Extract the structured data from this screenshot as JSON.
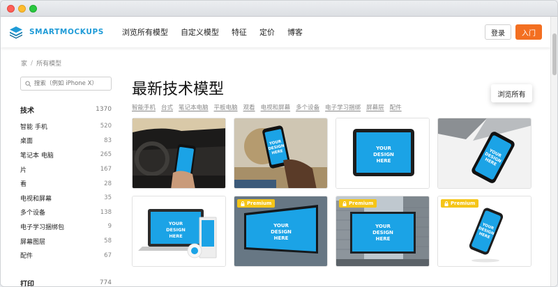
{
  "brand": {
    "name": "SMARTMOCKUPS",
    "accent": "#1f9bd7",
    "cta_color": "#f36f21"
  },
  "nav": {
    "links": [
      "浏览所有模型",
      "自定义模型",
      "特征",
      "定价",
      "博客"
    ],
    "login_label": "登录",
    "join_label": "入门"
  },
  "breadcrumb": {
    "home": "家",
    "current": "所有模型"
  },
  "search": {
    "placeholder": "搜索（例如 iPhone X）"
  },
  "sidebar": {
    "tech": {
      "label": "技术",
      "count": "1370"
    },
    "items": [
      {
        "label": "智能 手机",
        "count": "520"
      },
      {
        "label": "桌面",
        "count": "83"
      },
      {
        "label": "笔记本 电脑",
        "count": "265"
      },
      {
        "label": "片",
        "count": "167"
      },
      {
        "label": "看",
        "count": "28"
      },
      {
        "label": "电视和屏幕",
        "count": "35"
      },
      {
        "label": "多个设备",
        "count": "138"
      },
      {
        "label": "电子学习捆绑包",
        "count": "9"
      },
      {
        "label": "屏幕图层",
        "count": "58"
      },
      {
        "label": "配件",
        "count": "67"
      }
    ],
    "print": {
      "label": "打印",
      "count": "774"
    }
  },
  "main": {
    "title": "最新技术模型",
    "browse_all": "浏览所有",
    "filters": [
      "智能手机",
      "台式",
      "笔记本电脑",
      "平板电脑",
      "观看",
      "电视和屏幕",
      "多个设备",
      "电子学习捆绑",
      "屏幕层",
      "配件"
    ]
  },
  "mockups": {
    "design_text_1": "YOUR",
    "design_text_2": "DESIGN",
    "design_text_3": "HERE",
    "premium_label": "Premium",
    "screen_color": "#1ba3e6",
    "premium_color": "#f5c518"
  }
}
